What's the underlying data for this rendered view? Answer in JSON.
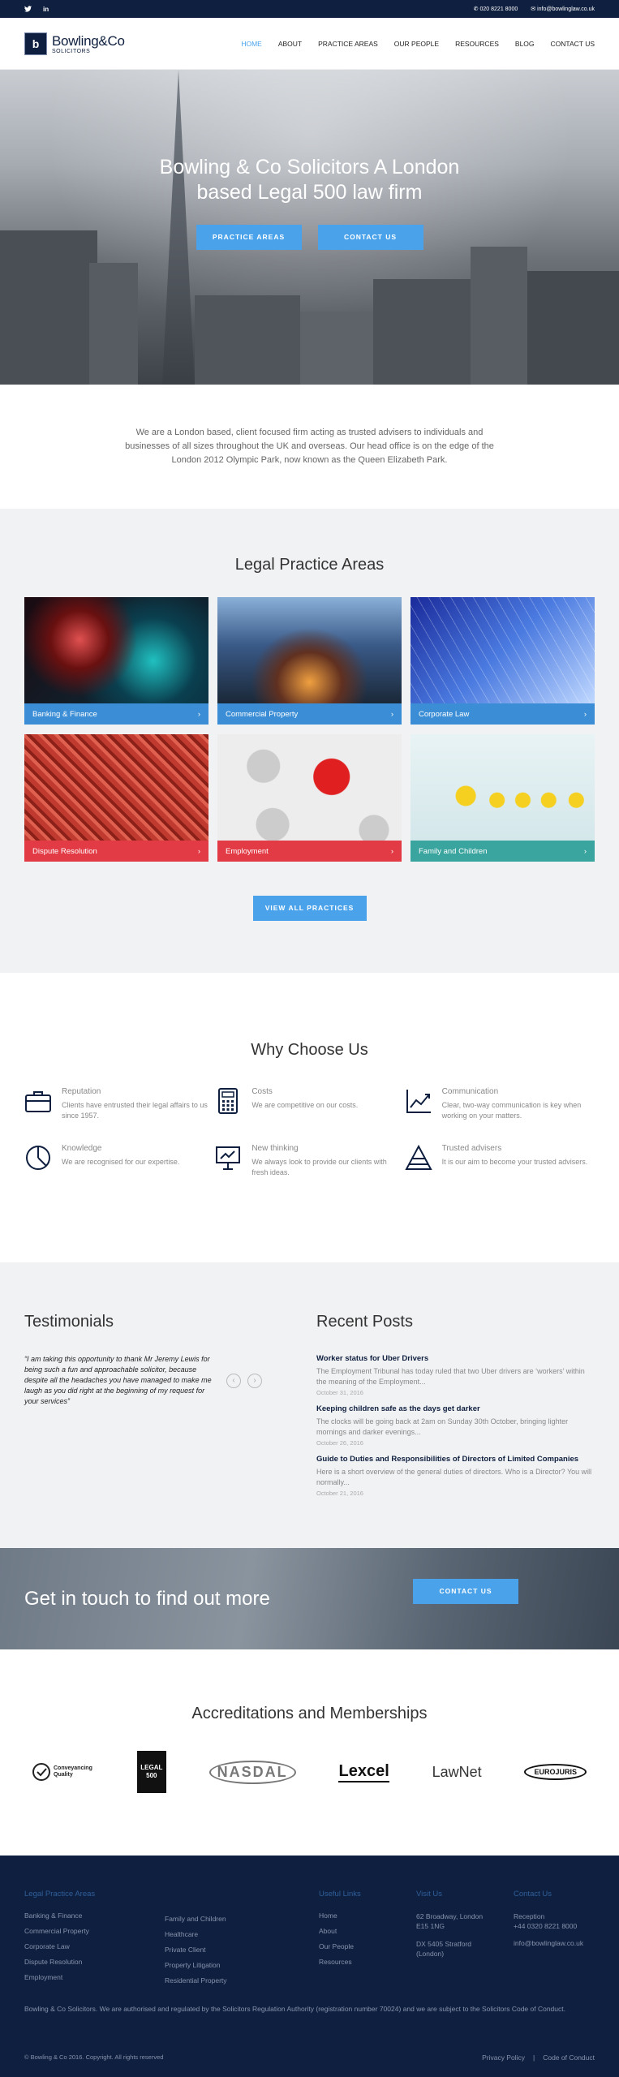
{
  "topbar": {
    "phone": "020 8221 8000",
    "email": "info@bowlinglaw.co.uk",
    "social": [
      "twitter-icon",
      "linkedin-icon"
    ],
    "linkedin_label": "in"
  },
  "header": {
    "logo_mark": "b",
    "logo_name": "Bowling&Co",
    "logo_sub": "SOLICITORS",
    "nav": [
      "HOME",
      "ABOUT",
      "PRACTICE AREAS",
      "OUR PEOPLE",
      "RESOURCES",
      "BLOG",
      "CONTACT US"
    ],
    "active_nav": "HOME"
  },
  "hero": {
    "title": "Bowling & Co Solicitors A London based Legal 500 law firm",
    "btn_practice": "PRACTICE AREAS",
    "btn_contact": "CONTACT US"
  },
  "intro": {
    "text": "We are a London based, client focused firm acting as trusted advisers to individuals and businesses of all sizes throughout the UK and overseas. Our head office is on the edge of the London 2012 Olympic Park, now known as the Queen Elizabeth Park."
  },
  "practices": {
    "title": "Legal Practice Areas",
    "items": [
      {
        "label": "Banking & Finance",
        "color": "#3b8ed6"
      },
      {
        "label": "Commercial Property",
        "color": "#3b8ed6"
      },
      {
        "label": "Corporate Law",
        "color": "#3b8ed6"
      },
      {
        "label": "Dispute Resolution",
        "color": "#e23b45"
      },
      {
        "label": "Employment",
        "color": "#e23b45"
      },
      {
        "label": "Family and Children",
        "color": "#3aa49e"
      }
    ],
    "view_all": "VIEW ALL PRACTICES"
  },
  "why": {
    "title": "Why Choose Us",
    "items": [
      {
        "title": "Reputation",
        "text": "Clients have entrusted their legal affairs to us since 1957.",
        "icon": "briefcase-icon"
      },
      {
        "title": "Costs",
        "text": "We are competitive on our costs.",
        "icon": "calculator-icon"
      },
      {
        "title": "Communication",
        "text": "Clear, two-way communication is key when working on your matters.",
        "icon": "line-chart-icon"
      },
      {
        "title": "Knowledge",
        "text": "We are recognised for our expertise.",
        "icon": "pie-chart-icon"
      },
      {
        "title": "New thinking",
        "text": "We always look to provide our clients with fresh ideas.",
        "icon": "presentation-icon"
      },
      {
        "title": "Trusted advisers",
        "text": "It is our aim to become your trusted advisers.",
        "icon": "pyramid-icon"
      }
    ]
  },
  "testimonials": {
    "title": "Testimonials",
    "quote": "“I am taking this opportunity to thank Mr Jeremy Lewis for being such a fun and approachable solicitor, because despite all the headaches you have managed to make me laugh as you did right at the beginning of my request for your services”"
  },
  "posts": {
    "title": "Recent Posts",
    "items": [
      {
        "title": "Worker status for Uber Drivers",
        "excerpt": "The Employment Tribunal has today ruled that two Uber drivers are ‘workers’ within the meaning of the Employment...",
        "date": "October 31, 2016"
      },
      {
        "title": "Keeping children safe as the days get darker",
        "excerpt": "The clocks will be going back at 2am on Sunday 30th October, bringing lighter mornings and darker evenings...",
        "date": "October 26, 2016"
      },
      {
        "title": "Guide to Duties and Responsibilities of Directors of Limited Companies",
        "excerpt": "Here is a short overview of the general duties of directors. Who is a Director? You will normally...",
        "date": "October 21, 2016"
      }
    ]
  },
  "cta": {
    "title": "Get in touch to find out more",
    "button": "CONTACT US"
  },
  "accreditations": {
    "title": "Accreditations and Memberships",
    "logos": [
      {
        "name": "conveyancing-quality-logo",
        "text": "Conveyancing Quality"
      },
      {
        "name": "legal-500-logo",
        "text": "LEGAL 500"
      },
      {
        "name": "nasdal-logo",
        "text": "NASDAL"
      },
      {
        "name": "lexcel-logo",
        "text": "Lexcel"
      },
      {
        "name": "lawnet-logo",
        "text": "LawNet"
      },
      {
        "name": "eurojuris-logo",
        "text": "EUROJURIS"
      }
    ]
  },
  "footer": {
    "practice_title": "Legal Practice Areas",
    "practice_col1": [
      "Banking & Finance",
      "Commercial Property",
      "Corporate Law",
      "Dispute Resolution",
      "Employment"
    ],
    "practice_col2": [
      "Family and Children",
      "Healthcare",
      "Private Client",
      "Property Litigation",
      "Residential Property"
    ],
    "useful_title": "Useful Links",
    "useful": [
      "Home",
      "About",
      "Our People",
      "Resources"
    ],
    "visit_title": "Visit Us",
    "address1": "62 Broadway, London E15 1NG",
    "address2": "DX 5405 Stratford (London)",
    "contact_title": "Contact Us",
    "reception": "Reception",
    "phone": "+44 0320 8221 8000",
    "email": "info@bowlinglaw.co.uk",
    "note": "Bowling & Co Solicitors. We are authorised and regulated by the Solicitors Regulation Authority (registration number 70024) and we are subject to the Solicitors Code of Conduct.",
    "copyright": "© Bowling & Co 2016. Copyright. All rights reserved",
    "privacy": "Privacy Policy",
    "separator": "|",
    "code": "Code of Conduct"
  }
}
